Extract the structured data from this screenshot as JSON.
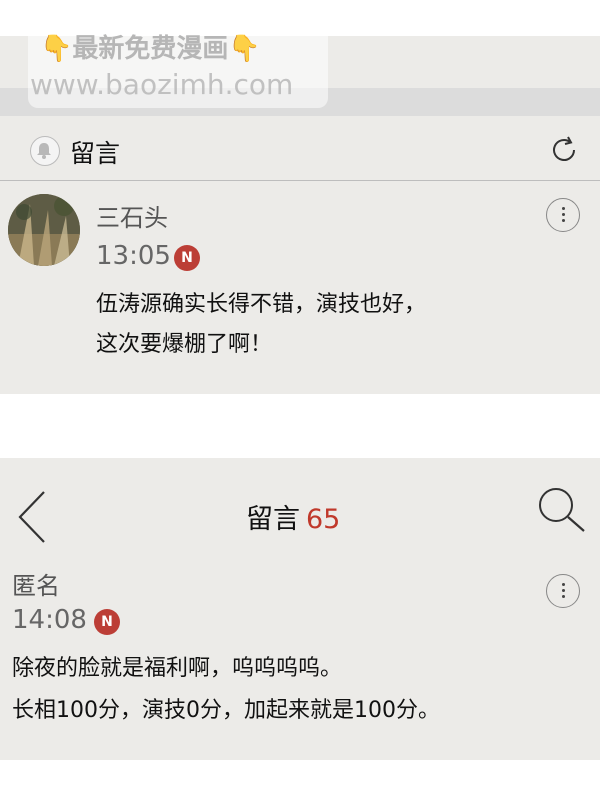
{
  "watermark": {
    "line1": "最新免费漫画",
    "line2": "www.baozimh.com"
  },
  "top_header": {
    "title": "留言",
    "icons": [
      "bell-icon",
      "refresh-icon"
    ]
  },
  "comment1": {
    "username": "三石头",
    "time": "13:05",
    "badge": "N",
    "lines": [
      "伍涛源确实长得不错，演技也好，",
      "这次要爆棚了啊！"
    ]
  },
  "second_header": {
    "title": "留言",
    "count": "65",
    "icons": [
      "back-arrow-icon",
      "search-icon"
    ]
  },
  "comment2": {
    "username": "匿名",
    "time": "14:08",
    "badge": "N",
    "lines": [
      "除夜的脸就是福利啊，呜呜呜呜。",
      "长相100分，演技0分，加起来就是100分。"
    ]
  },
  "colors": {
    "panel_bg": "#ecebe8",
    "badge_red": "#bc3e36",
    "count_red": "#c0392b"
  }
}
